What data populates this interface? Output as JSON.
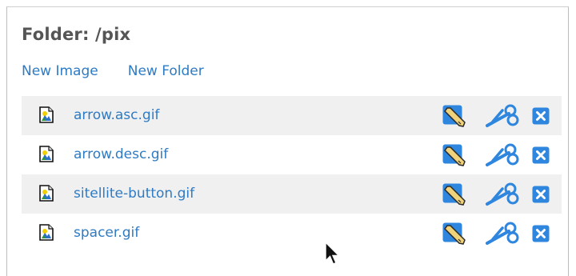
{
  "folder": {
    "title": "Folder: /pix"
  },
  "actions": {
    "new_image": "New Image",
    "new_folder": "New Folder"
  },
  "files": [
    {
      "name": "arrow.asc.gif",
      "icon": "image-file-icon"
    },
    {
      "name": "arrow.desc.gif",
      "icon": "image-file-icon"
    },
    {
      "name": "sitellite-button.gif",
      "icon": "image-file-icon"
    },
    {
      "name": "spacer.gif",
      "icon": "image-file-icon"
    }
  ],
  "row_action_icons": [
    "edit-icon",
    "cut-icon",
    "delete-icon"
  ],
  "colors": {
    "link": "#2e7bc4",
    "heading": "#555555",
    "row_alt": "#f0f0f0",
    "action_blue": "#2e86de"
  }
}
